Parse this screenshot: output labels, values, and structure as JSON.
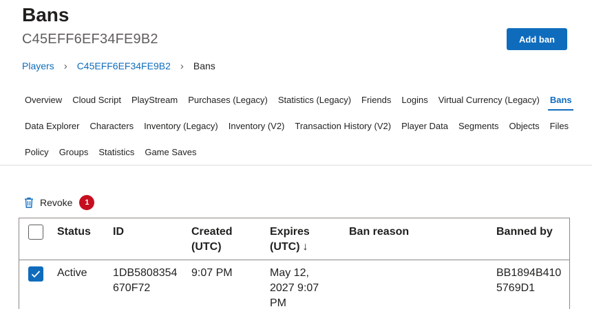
{
  "header": {
    "title": "Bans",
    "player_id": "C45EFF6EF34FE9B2",
    "add_ban_label": "Add ban"
  },
  "breadcrumb": {
    "items": [
      "Players",
      "C45EFF6EF34FE9B2",
      "Bans"
    ]
  },
  "tabs": {
    "rows": [
      [
        "Overview",
        "Cloud Script",
        "PlayStream",
        "Purchases (Legacy)",
        "Statistics (Legacy)",
        "Friends",
        "Logins",
        "Virtual Currency (Legacy)",
        "Bans"
      ],
      [
        "Data Explorer",
        "Characters",
        "Inventory (Legacy)",
        "Inventory (V2)",
        "Transaction History (V2)",
        "Player Data",
        "Segments",
        "Objects",
        "Files"
      ],
      [
        "Policy",
        "Groups",
        "Statistics",
        "Game Saves"
      ]
    ],
    "active": "Bans"
  },
  "toolbar": {
    "revoke_label": "Revoke",
    "selected_count": "1",
    "trash_icon": "trash-icon"
  },
  "table": {
    "columns": {
      "status": "Status",
      "id": "ID",
      "created_line1": "Created",
      "created_line2": "(UTC)",
      "expires_line1": "Expires",
      "expires_line2": "(UTC)",
      "sort_indicator": "↓",
      "ban_reason": "Ban reason",
      "banned_by": "Banned by"
    },
    "rows": [
      {
        "checked": true,
        "status": "Active",
        "id_line1": "1DB5808354",
        "id_line2": "670F72",
        "created": "9:07 PM",
        "expires_line1": "May 12,",
        "expires_line2": "2027 9:07",
        "expires_line3": "PM",
        "ban_reason": "",
        "banned_by_line1": "BB1894B410",
        "banned_by_line2": "5769D1"
      }
    ]
  },
  "colors": {
    "accent": "#0f6cbd",
    "badge": "#c50f1f",
    "text": "#201f1e",
    "muted": "#605e5c"
  }
}
